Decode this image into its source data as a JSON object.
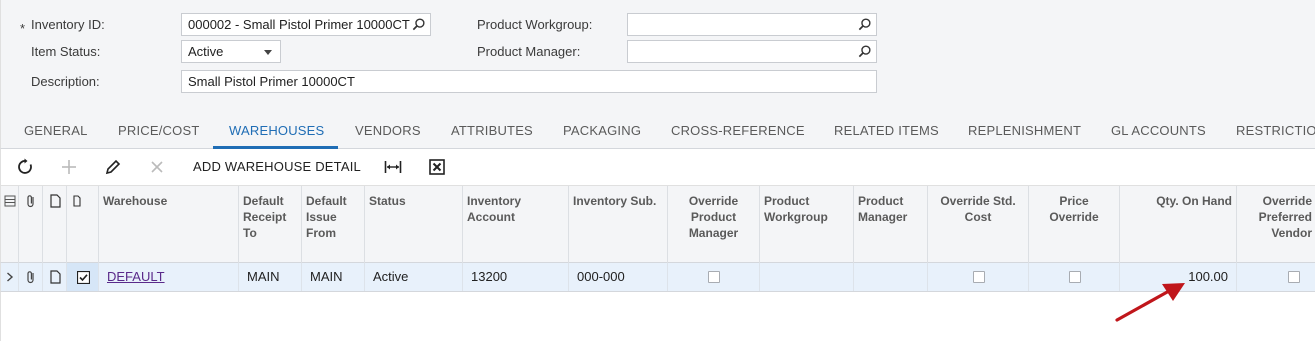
{
  "form": {
    "required_mark": "*",
    "inventory_id_label": "Inventory ID:",
    "inventory_id_value": "000002 - Small Pistol Primer 10000CT",
    "item_status_label": "Item Status:",
    "item_status_value": "Active",
    "description_label": "Description:",
    "description_value": "Small Pistol Primer 10000CT",
    "product_workgroup_label": "Product Workgroup:",
    "product_workgroup_value": "",
    "product_manager_label": "Product Manager:",
    "product_manager_value": ""
  },
  "tabs": [
    "GENERAL",
    "PRICE/COST",
    "WAREHOUSES",
    "VENDORS",
    "ATTRIBUTES",
    "PACKAGING",
    "CROSS-REFERENCE",
    "RELATED ITEMS",
    "REPLENISHMENT",
    "GL ACCOUNTS",
    "RESTRICTIO"
  ],
  "active_tab": "WAREHOUSES",
  "toolbar": {
    "add_detail_label": "ADD WAREHOUSE DETAIL",
    "icons": [
      "refresh-icon",
      "add-icon",
      "edit-icon",
      "delete-icon",
      "fit-columns-icon",
      "excel-export-icon"
    ]
  },
  "grid": {
    "columns": [
      "Warehouse",
      "Default Receipt To",
      "Default Issue From",
      "Status",
      "Inventory Account",
      "Inventory Sub.",
      "Override Product Manager",
      "Product Workgroup",
      "Product Manager",
      "Override Std. Cost",
      "Price Override",
      "Qty. On Hand",
      "Override Preferred Vendor"
    ],
    "row": {
      "warehouse": "DEFAULT",
      "receipt_to": "MAIN",
      "issue_from": "MAIN",
      "status": "Active",
      "inventory_account": "13200",
      "inventory_sub": "000-000",
      "override_product_manager": false,
      "product_workgroup": "",
      "product_manager": "",
      "override_std_cost": false,
      "price_override": false,
      "qty_on_hand": "100.00",
      "override_preferred_vendor": false,
      "is_default": true
    }
  },
  "colors": {
    "accent": "#1f6db5",
    "row_highlight": "#e8f1fb",
    "link": "#5a2a8a",
    "annotation_arrow": "#c0161b"
  }
}
